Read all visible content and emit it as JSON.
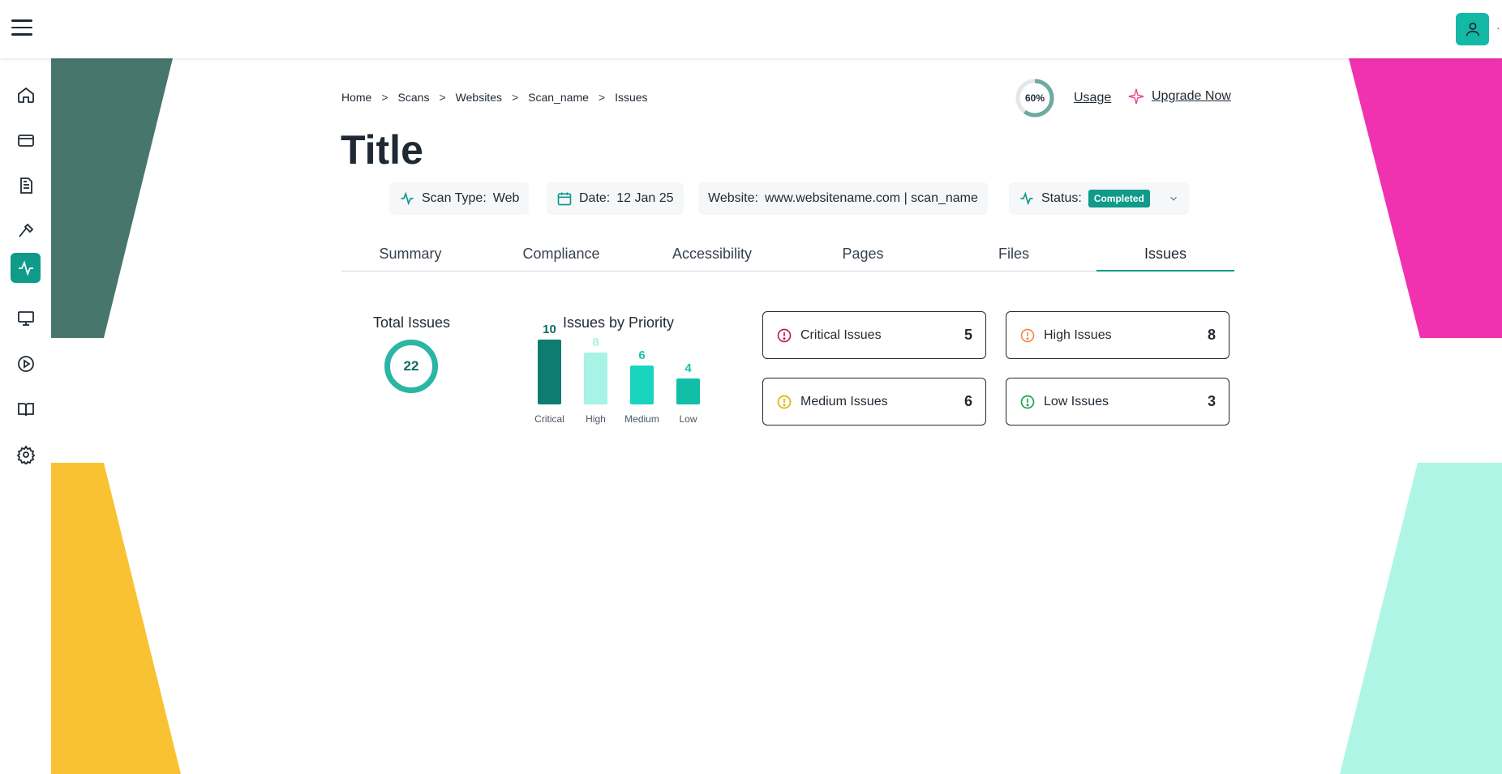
{
  "breadcrumb": [
    "Home",
    "Scans",
    "Websites",
    "Scan_name",
    "Issues"
  ],
  "breadcrumb_separator": ">",
  "usage": {
    "percent_label": "60%",
    "percent_value": 0.6,
    "link_label": "Usage"
  },
  "upgrade": {
    "label": "Upgrade Now"
  },
  "page_title": "Title",
  "meta": {
    "scan_type": {
      "key": "Scan Type:",
      "value": "Web"
    },
    "date": {
      "key": "Date:",
      "value": "12 Jan 25"
    },
    "website": {
      "key": "Website:",
      "value": "www.websitename.com | scan_name"
    },
    "status": {
      "key": "Status:",
      "value": "Completed"
    }
  },
  "tabs": [
    {
      "label": "Summary"
    },
    {
      "label": "Compliance"
    },
    {
      "label": "Accessibility"
    },
    {
      "label": "Pages"
    },
    {
      "label": "Files"
    },
    {
      "label": "Issues"
    }
  ],
  "active_tab": "Issues",
  "total_issues": {
    "title": "Total Issues",
    "value": "22"
  },
  "priority_chart_title": "Issues by Priority",
  "chart_data": {
    "type": "bar",
    "categories": [
      "Critical",
      "High",
      "Medium",
      "Low"
    ],
    "values": [
      10,
      8,
      6,
      4
    ],
    "colors": [
      "#0f7c72",
      "#a7f3e5",
      "#19d4bf",
      "#11bfa8"
    ],
    "value_label_colors": [
      "#0f6b63",
      "#a7f3e5",
      "#19c0ad",
      "#19c0ad"
    ],
    "title": "Issues by Priority",
    "ylim": [
      0,
      10
    ]
  },
  "issue_cards": [
    {
      "label": "Critical Issues",
      "count": "5",
      "color": "#c2185b"
    },
    {
      "label": "High Issues",
      "count": "8",
      "color": "#f08a4b"
    },
    {
      "label": "Medium Issues",
      "count": "6",
      "color": "#e0b300"
    },
    {
      "label": "Low Issues",
      "count": "3",
      "color": "#16a34a"
    }
  ],
  "sidebar_icons": [
    "home-icon",
    "card-icon",
    "document-icon",
    "hammer-icon",
    "activity-icon",
    "monitor-icon",
    "play-icon",
    "book-icon",
    "gear-icon"
  ],
  "accent_color": "#0f9a8a"
}
